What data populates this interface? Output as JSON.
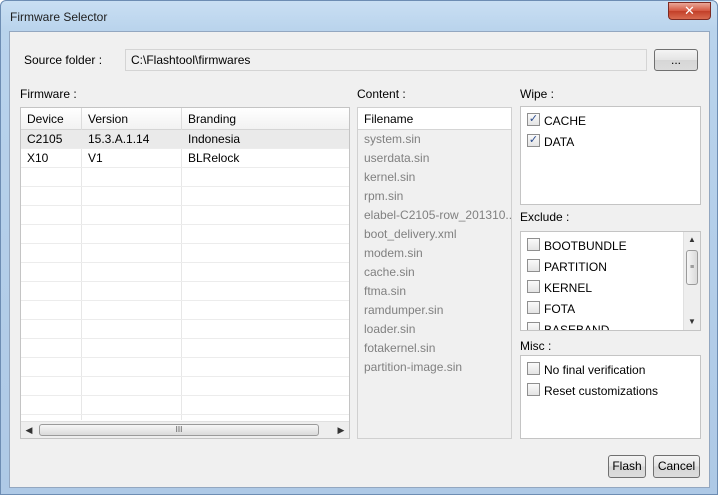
{
  "window": {
    "title": "Firmware Selector",
    "close_glyph": "✕"
  },
  "source": {
    "label": "Source folder :",
    "value": "C:\\Flashtool\\firmwares",
    "browse_label": "..."
  },
  "firmware": {
    "label": "Firmware :",
    "columns": [
      "Device",
      "Version",
      "Branding"
    ],
    "rows": [
      {
        "device": "C2105",
        "version": "15.3.A.1.14",
        "branding": "Indonesia",
        "selected": true
      },
      {
        "device": "X10",
        "version": "V1",
        "branding": "BLRelock",
        "selected": false
      }
    ]
  },
  "content": {
    "label": "Content :",
    "header": "Filename",
    "files": [
      "system.sin",
      "userdata.sin",
      "kernel.sin",
      "rpm.sin",
      "elabel-C2105-row_201310...",
      "boot_delivery.xml",
      "modem.sin",
      "cache.sin",
      "ftma.sin",
      "ramdumper.sin",
      "loader.sin",
      "fotakernel.sin",
      "partition-image.sin"
    ]
  },
  "wipe": {
    "label": "Wipe :",
    "items": [
      {
        "label": "CACHE",
        "checked": true
      },
      {
        "label": "DATA",
        "checked": true
      }
    ]
  },
  "exclude": {
    "label": "Exclude :",
    "items": [
      {
        "label": "BOOTBUNDLE",
        "checked": false
      },
      {
        "label": "PARTITION",
        "checked": false
      },
      {
        "label": "KERNEL",
        "checked": false
      },
      {
        "label": "FOTA",
        "checked": false
      },
      {
        "label": "BASEBAND",
        "checked": false
      }
    ]
  },
  "misc": {
    "label": "Misc :",
    "items": [
      {
        "label": "No final verification",
        "checked": false
      },
      {
        "label": "Reset customizations",
        "checked": false
      }
    ]
  },
  "buttons": {
    "flash": "Flash",
    "cancel": "Cancel"
  },
  "icons": {
    "check": "✓",
    "arrow_left": "◀",
    "arrow_right": "▶",
    "arrow_up": "▲",
    "arrow_down": "▼",
    "grip_h": "III",
    "grip_v": "≡"
  },
  "colors": {
    "titlebar": "#b9d3ec",
    "close": "#c94a34",
    "client": "#f0f0f0",
    "disabled_text": "#808080"
  }
}
